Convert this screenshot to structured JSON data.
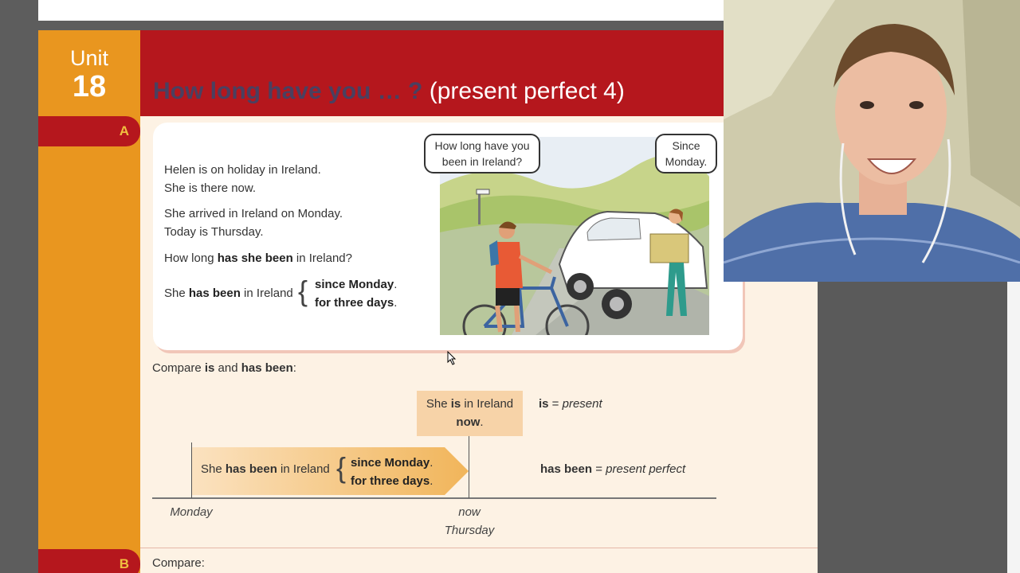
{
  "unit": {
    "word": "Unit",
    "number": "18"
  },
  "title": {
    "bold": "How long have you … ?",
    "rest": "(present perfect 4)"
  },
  "sections": {
    "a": "A",
    "b": "B"
  },
  "story": {
    "line1a": "Helen is on holiday in Ireland.",
    "line1b": "She is there now.",
    "line2a": "She arrived in Ireland on Monday.",
    "line2b": "Today is Thursday.",
    "q_pre": "How long ",
    "q_bold": "has she been",
    "q_post": " in Ireland?",
    "ans_pre": "She ",
    "ans_bold": "has been",
    "ans_post": " in Ireland",
    "opt1": "since Monday",
    "opt2": "for three days",
    "dot": "."
  },
  "bubbles": {
    "question_l1": "How long have you",
    "question_l2": "been in Ireland?",
    "answer_l1": "Since",
    "answer_l2": "Monday."
  },
  "compare": {
    "label_pre": "Compare ",
    "is": "is",
    "and": " and ",
    "has_been": "has been",
    "colon": ":",
    "now_box_pre": "She ",
    "now_box_is": "is",
    "now_box_post": " in Ireland",
    "now_box_now": "now",
    "is_word": "is",
    "eq": " = ",
    "present": "present",
    "hb_pre": "She ",
    "hb_bold": "has been",
    "hb_post": " in Ireland",
    "hb_opt1": "since Monday",
    "hb_opt2": "for three days",
    "hb_word": "has been",
    "present_perfect": "present perfect",
    "monday": "Monday",
    "now": "now",
    "thursday": "Thursday"
  },
  "section_b": {
    "compare": "Compare:"
  },
  "colors": {
    "red": "#b5171d",
    "orange": "#e9961f",
    "cream": "#fdf2e4",
    "gold": "#f0c040"
  }
}
